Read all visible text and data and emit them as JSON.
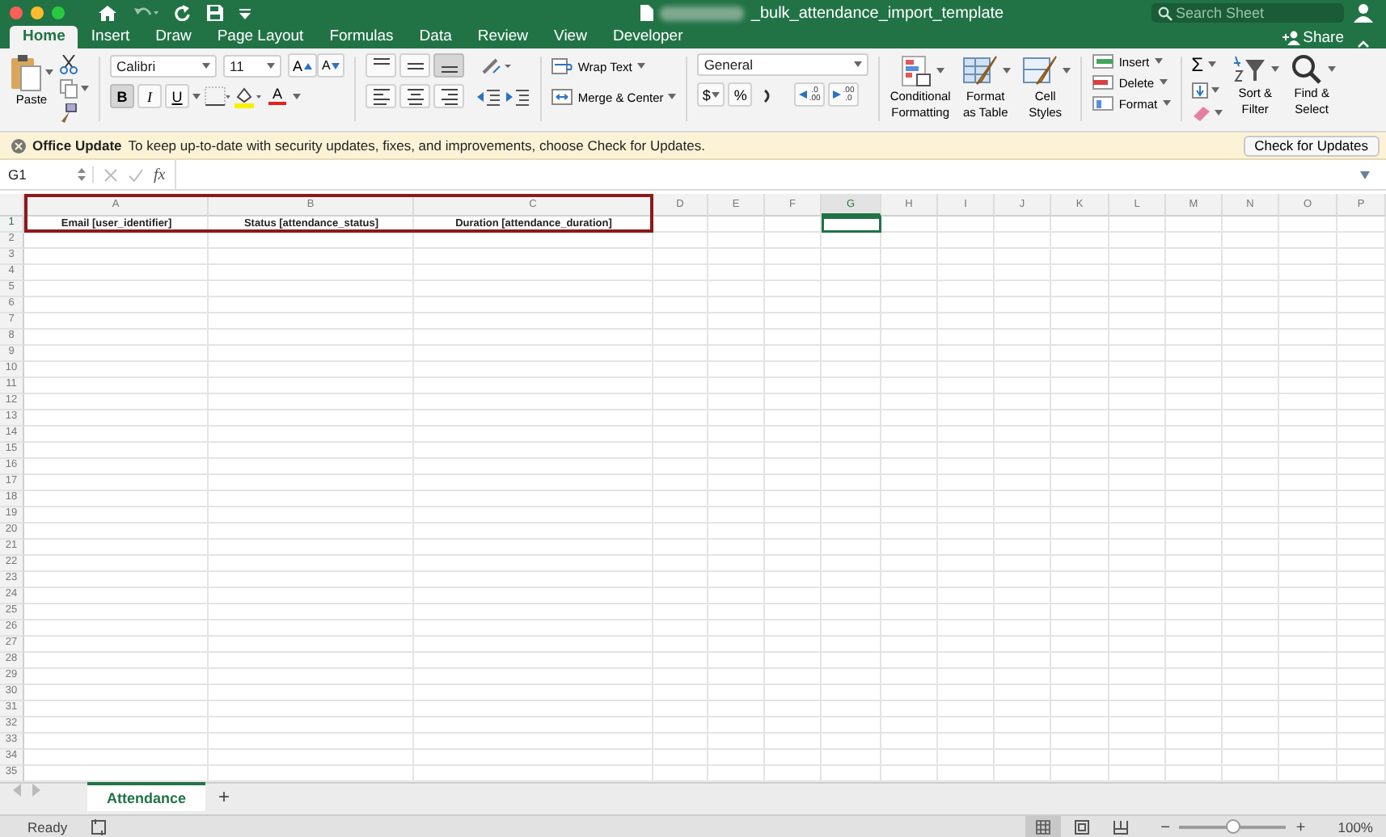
{
  "window": {
    "title": "_bulk_attendance_import_template"
  },
  "search": {
    "placeholder": "Search Sheet"
  },
  "tabs": [
    {
      "label": "Home",
      "selected": true
    },
    {
      "label": "Insert",
      "selected": false
    },
    {
      "label": "Draw",
      "selected": false
    },
    {
      "label": "Page Layout",
      "selected": false
    },
    {
      "label": "Formulas",
      "selected": false
    },
    {
      "label": "Data",
      "selected": false
    },
    {
      "label": "Review",
      "selected": false
    },
    {
      "label": "View",
      "selected": false
    },
    {
      "label": "Developer",
      "selected": false
    }
  ],
  "share": {
    "label": "Share"
  },
  "ribbon": {
    "paste": "Paste",
    "font": "Calibri",
    "font_size": "11",
    "grow_font": "A",
    "shrink_font": "A",
    "styles": [
      {
        "kind": "bold",
        "label": "B",
        "selected": true
      },
      {
        "kind": "italic",
        "label": "I",
        "selected": false
      },
      {
        "kind": "underline",
        "label": "U",
        "selected": false
      }
    ],
    "font_color": "A",
    "vertical_align": [
      {
        "kind": "top",
        "selected": false
      },
      {
        "kind": "middle",
        "selected": false
      },
      {
        "kind": "bottom",
        "selected": true
      }
    ],
    "horizontal_align": [
      {
        "kind": "left",
        "selected": false
      },
      {
        "kind": "center",
        "selected": false
      },
      {
        "kind": "right",
        "selected": false
      }
    ],
    "wrap_text": "Wrap Text",
    "merge": "Merge & Center",
    "number_format": "General",
    "currency": "$",
    "percent": "%",
    "decimals": [
      {
        "top": ".0",
        "bottom": ".00"
      },
      {
        "top": ".00",
        "bottom": ".0"
      }
    ],
    "style_commands": [
      {
        "kind": "conditional",
        "lines": [
          "Conditional",
          "Formatting"
        ]
      },
      {
        "kind": "table",
        "lines": [
          "Format",
          "as Table"
        ]
      },
      {
        "kind": "cell",
        "lines": [
          "Cell",
          "Styles"
        ]
      }
    ],
    "cell_commands": [
      {
        "kind": "insert",
        "label": "Insert"
      },
      {
        "kind": "delete",
        "label": "Delete"
      },
      {
        "kind": "format",
        "label": "Format"
      }
    ],
    "sum": "Σ",
    "edit_commands": [
      {
        "kind": "sort",
        "lines": [
          "Sort &",
          "Filter"
        ]
      },
      {
        "kind": "find",
        "lines": [
          "Find &",
          "Select"
        ]
      }
    ]
  },
  "update_bar": {
    "title": "Office Update",
    "message": "To keep up-to-date with security updates, fixes, and improvements, choose Check for Updates.",
    "button": "Check for Updates"
  },
  "formula_bar": {
    "name_box": "G1",
    "fx": "fx"
  },
  "sheet": {
    "columns": [
      {
        "label": "A",
        "selected": false
      },
      {
        "label": "B",
        "selected": false
      },
      {
        "label": "C",
        "selected": false
      },
      {
        "label": "D",
        "selected": false
      },
      {
        "label": "E",
        "selected": false
      },
      {
        "label": "F",
        "selected": false
      },
      {
        "label": "G",
        "selected": true
      },
      {
        "label": "H",
        "selected": false
      },
      {
        "label": "I",
        "selected": false
      },
      {
        "label": "J",
        "selected": false
      },
      {
        "label": "K",
        "selected": false
      },
      {
        "label": "L",
        "selected": false
      },
      {
        "label": "M",
        "selected": false
      },
      {
        "label": "N",
        "selected": false
      },
      {
        "label": "O",
        "selected": false
      },
      {
        "label": "P",
        "selected": false
      }
    ],
    "rows": [
      {
        "number": "1",
        "selected": true,
        "cells": [
          "Email [user_identifier]",
          "Status [attendance_status]",
          "Duration [attendance_duration]"
        ]
      },
      {
        "number": "2",
        "selected": false
      },
      {
        "number": "3",
        "selected": false
      },
      {
        "number": "4",
        "selected": false
      },
      {
        "number": "5",
        "selected": false
      },
      {
        "number": "6",
        "selected": false
      },
      {
        "number": "7",
        "selected": false
      },
      {
        "number": "8",
        "selected": false
      },
      {
        "number": "9",
        "selected": false
      },
      {
        "number": "10",
        "selected": false
      },
      {
        "number": "11",
        "selected": false
      },
      {
        "number": "12",
        "selected": false
      },
      {
        "number": "13",
        "selected": false
      },
      {
        "number": "14",
        "selected": false
      },
      {
        "number": "15",
        "selected": false
      },
      {
        "number": "16",
        "selected": false
      },
      {
        "number": "17",
        "selected": false
      },
      {
        "number": "18",
        "selected": false
      },
      {
        "number": "19",
        "selected": false
      },
      {
        "number": "20",
        "selected": false
      },
      {
        "number": "21",
        "selected": false
      },
      {
        "number": "22",
        "selected": false
      },
      {
        "number": "23",
        "selected": false
      },
      {
        "number": "24",
        "selected": false
      },
      {
        "number": "25",
        "selected": false
      },
      {
        "number": "26",
        "selected": false
      },
      {
        "number": "27",
        "selected": false
      },
      {
        "number": "28",
        "selected": false
      },
      {
        "number": "29",
        "selected": false
      },
      {
        "number": "30",
        "selected": false
      },
      {
        "number": "31",
        "selected": false
      },
      {
        "number": "32",
        "selected": false
      },
      {
        "number": "33",
        "selected": false
      },
      {
        "number": "34",
        "selected": false
      },
      {
        "number": "35",
        "selected": false
      }
    ]
  },
  "sheet_tabs": [
    {
      "label": "Attendance",
      "selected": true
    }
  ],
  "add_sheet": "+",
  "status_bar": {
    "status": "Ready",
    "views": [
      {
        "kind": "normal",
        "selected": true
      },
      {
        "kind": "layout",
        "selected": false
      },
      {
        "kind": "break",
        "selected": false
      }
    ],
    "zoom_out": "−",
    "zoom_in": "+",
    "zoom": {
      "level": 0.5
    },
    "zoom_label": "100%"
  }
}
